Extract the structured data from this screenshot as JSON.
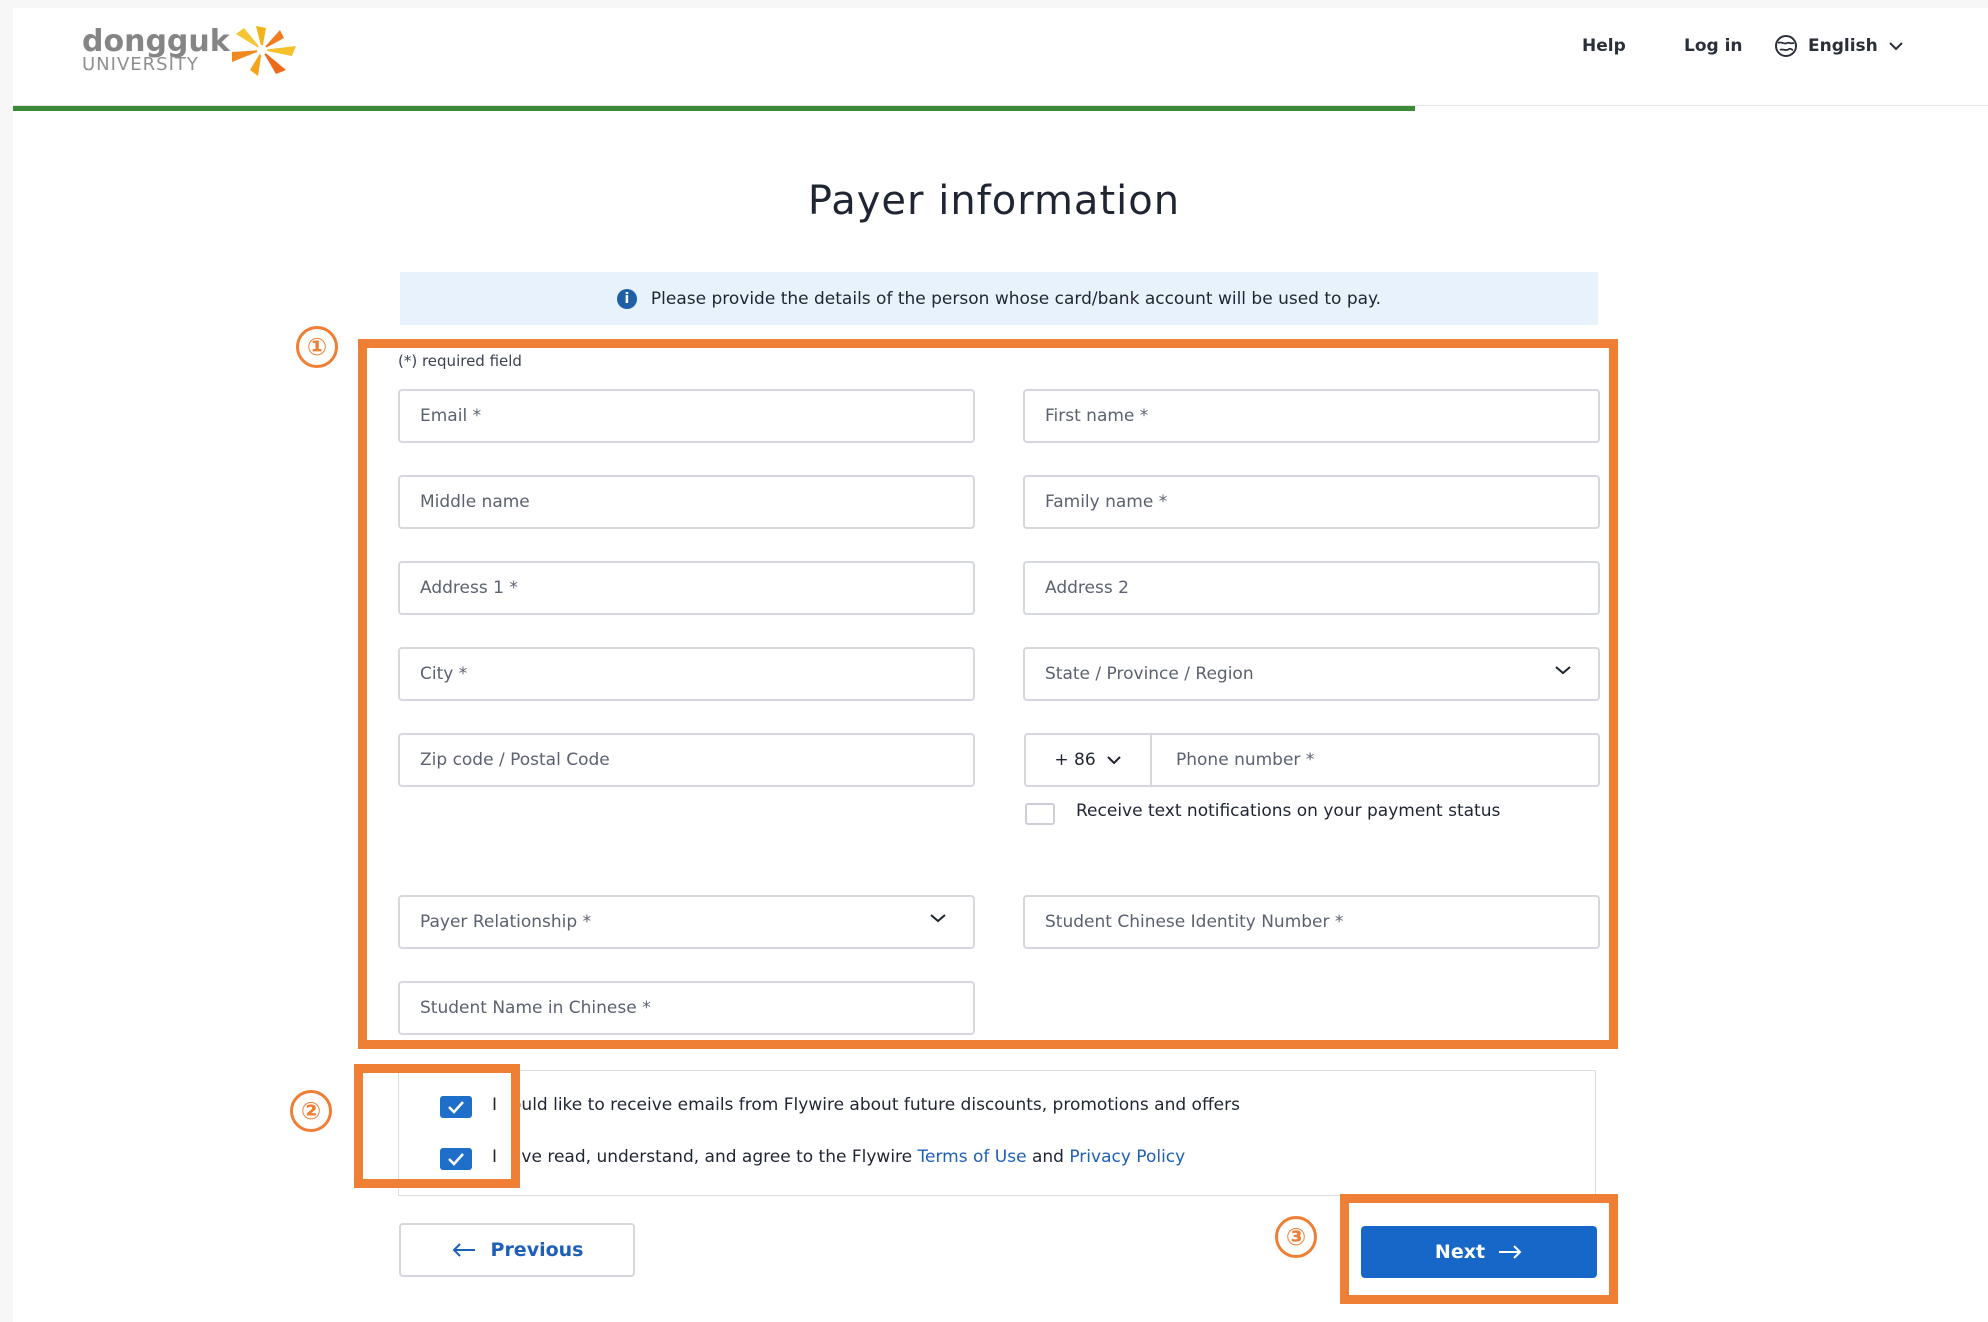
{
  "header": {
    "logo_word": "dongguk",
    "logo_sub": "UNIVERSITY",
    "help": "Help",
    "login": "Log in",
    "language": "English"
  },
  "page_title": "Payer information",
  "info_banner": "Please provide the details of the person whose card/bank account will be used to pay.",
  "form": {
    "required_note": "(*) required field",
    "email": "Email *",
    "first_name": "First name *",
    "middle_name": "Middle name",
    "family_name": "Family name *",
    "address1": "Address 1 *",
    "address2": "Address 2",
    "city": "City *",
    "state": "State / Province / Region",
    "zip": "Zip code / Postal Code",
    "country_code": "+ 86",
    "phone": "Phone number *",
    "sms_label": "Receive text notifications on your payment status",
    "payer_relationship": "Payer Relationship *",
    "student_id": "Student Chinese Identity Number *",
    "student_name": "Student Name in Chinese *"
  },
  "consent": {
    "emails_prefix": "I",
    "emails_rest": "ould like to receive emails from Flywire about future discounts, promotions and offers",
    "terms_prefix": "I",
    "terms_mid": "ave read, understand, and agree to the Flywire ",
    "terms_link": "Terms of Use",
    "and": " and ",
    "privacy_link": "Privacy Policy"
  },
  "buttons": {
    "previous": "Previous",
    "next": "Next"
  },
  "callouts": [
    "①",
    "②",
    "③"
  ],
  "colors": {
    "accent": "#1667c8",
    "callout": "#ee7f34",
    "progress": "#3a8a3a",
    "banner": "#e8f2fc"
  }
}
